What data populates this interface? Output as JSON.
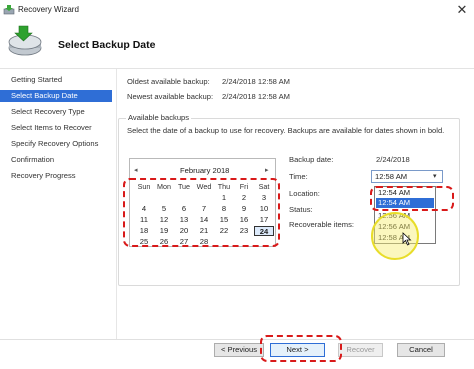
{
  "window": {
    "title": "Recovery Wizard",
    "close_glyph": "✕"
  },
  "header": {
    "title": "Select Backup Date"
  },
  "sidebar": {
    "items": [
      {
        "label": "Getting Started"
      },
      {
        "label": "Select Backup Date"
      },
      {
        "label": "Select Recovery Type"
      },
      {
        "label": "Select Items to Recover"
      },
      {
        "label": "Specify Recovery Options"
      },
      {
        "label": "Confirmation"
      },
      {
        "label": "Recovery Progress"
      }
    ],
    "selected_index": 1
  },
  "summary": {
    "oldest_label": "Oldest available backup:",
    "oldest_value": "2/24/2018 12:58 AM",
    "newest_label": "Newest available backup:",
    "newest_value": "2/24/2018 12:58 AM"
  },
  "available": {
    "legend": "Available backups",
    "description": "Select the date of a backup to use for recovery. Backups are available for dates shown in bold."
  },
  "calendar": {
    "prev_glyph": "◂",
    "next_glyph": "▸",
    "month": "February 2018",
    "day_headers": [
      "Sun",
      "Mon",
      "Tue",
      "Wed",
      "Thu",
      "Fri",
      "Sat"
    ],
    "weeks": [
      [
        "",
        "",
        "",
        "",
        "1",
        "2",
        "3"
      ],
      [
        "4",
        "5",
        "6",
        "7",
        "8",
        "9",
        "10"
      ],
      [
        "11",
        "12",
        "13",
        "14",
        "15",
        "16",
        "17"
      ],
      [
        "18",
        "19",
        "20",
        "21",
        "22",
        "23",
        "24"
      ],
      [
        "25",
        "26",
        "27",
        "28",
        "",
        "",
        ""
      ]
    ],
    "selected_day": "24"
  },
  "details": {
    "backup_date_label": "Backup date:",
    "backup_date_value": "2/24/2018",
    "time_label": "Time:",
    "time_value": "12:58 AM",
    "location_label": "Location:",
    "status_label": "Status:",
    "recoverable_label": "Recoverable items:",
    "time_options": [
      "12:54 AM",
      "12:54 AM",
      "12:56 AM",
      "12:56 AM",
      "12:58 AM"
    ],
    "hovered_option_index": 1
  },
  "buttons": {
    "previous": "< Previous",
    "next": "Next >",
    "recover": "Recover",
    "cancel": "Cancel"
  },
  "colors": {
    "selection": "#2f6ed6",
    "highlight": "#d91a1a",
    "cursor_ring": "#e8dd2a"
  }
}
